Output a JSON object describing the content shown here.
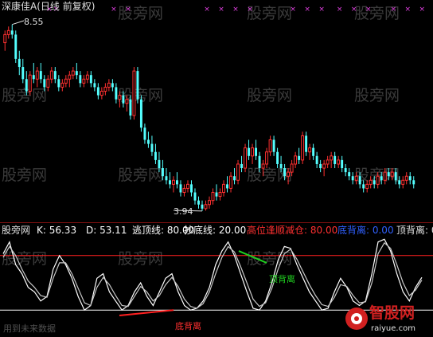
{
  "title": "深康佳A(日线 前复权)",
  "watermark": "股旁网",
  "colors": {
    "up": "#ff3030",
    "down": "#54ffff",
    "k": "#ffffff",
    "d": "#c8c8c8",
    "top_line": "#ff2020",
    "bottom_line": "#ffffff",
    "top_div": "#20d020",
    "bottom_div": "#ff2020"
  },
  "price_labels": {
    "high": "8.55",
    "low": "3.94"
  },
  "indicator": {
    "name": "股旁网",
    "k_label": "K: 56.33",
    "d_label": "D: 53.11",
    "escape_label": "逃顶线: 80.00",
    "bottom_label": "抄底线: 20.00",
    "reduce_label": "高位逢顺减仓: 80.00",
    "bottom_div_label": "底背离: 0.00",
    "top_div_label": "顶背离: 0"
  },
  "annotations": {
    "top_divergence": "顶背离",
    "bottom_divergence": "底背离",
    "footer_left": "用到未来数据"
  },
  "logo": {
    "name": "智股网",
    "url": "raiyue.com"
  },
  "chart_data": [
    {
      "type": "candlestick",
      "title": "深康佳A(日线 前复权)",
      "high_label": 8.55,
      "low_label": 3.94,
      "ylim": [
        3.8,
        8.8
      ],
      "candles": [
        [
          8.1,
          8.4,
          7.9,
          8.3
        ],
        [
          8.3,
          8.5,
          8.2,
          8.4
        ],
        [
          8.4,
          8.55,
          8.2,
          8.3
        ],
        [
          8.3,
          8.4,
          7.6,
          7.7
        ],
        [
          7.7,
          7.9,
          7.3,
          7.5
        ],
        [
          7.5,
          7.7,
          7.1,
          7.2
        ],
        [
          7.2,
          7.4,
          6.8,
          6.9
        ],
        [
          6.9,
          7.4,
          6.8,
          7.3
        ],
        [
          7.3,
          7.6,
          7.1,
          7.2
        ],
        [
          7.2,
          7.5,
          7.0,
          7.4
        ],
        [
          7.4,
          7.6,
          7.1,
          7.2
        ],
        [
          7.2,
          7.3,
          6.9,
          7.0
        ],
        [
          7.0,
          7.3,
          6.9,
          7.2
        ],
        [
          7.2,
          7.5,
          7.1,
          7.4
        ],
        [
          7.4,
          7.5,
          7.1,
          7.2
        ],
        [
          7.2,
          7.3,
          6.9,
          7.0
        ],
        [
          7.0,
          7.2,
          6.9,
          7.1
        ],
        [
          7.1,
          7.3,
          7.0,
          7.2
        ],
        [
          7.2,
          7.4,
          7.0,
          7.3
        ],
        [
          7.3,
          7.5,
          7.2,
          7.4
        ],
        [
          7.4,
          7.6,
          7.2,
          7.3
        ],
        [
          7.3,
          7.4,
          7.0,
          7.1
        ],
        [
          7.1,
          7.3,
          7.0,
          7.2
        ],
        [
          7.2,
          7.4,
          7.1,
          7.3
        ],
        [
          7.3,
          7.4,
          7.0,
          7.1
        ],
        [
          7.1,
          7.2,
          6.9,
          7.0
        ],
        [
          7.0,
          7.1,
          6.7,
          6.8
        ],
        [
          6.8,
          7.0,
          6.7,
          6.9
        ],
        [
          6.9,
          7.1,
          6.8,
          7.0
        ],
        [
          7.0,
          7.2,
          6.9,
          7.1
        ],
        [
          7.1,
          7.2,
          6.9,
          7.0
        ],
        [
          7.0,
          7.1,
          6.6,
          6.7
        ],
        [
          6.7,
          6.9,
          6.5,
          6.8
        ],
        [
          6.8,
          6.9,
          6.5,
          6.6
        ],
        [
          6.6,
          6.8,
          6.4,
          6.7
        ],
        [
          6.7,
          6.8,
          6.2,
          6.3
        ],
        [
          6.3,
          7.5,
          6.2,
          7.4
        ],
        [
          7.4,
          7.5,
          6.6,
          6.7
        ],
        [
          6.7,
          6.8,
          5.9,
          6.0
        ],
        [
          6.0,
          6.1,
          5.6,
          5.7
        ],
        [
          5.7,
          5.9,
          5.5,
          5.6
        ],
        [
          5.6,
          5.8,
          5.3,
          5.4
        ],
        [
          5.4,
          5.6,
          5.1,
          5.2
        ],
        [
          5.2,
          5.4,
          4.9,
          5.0
        ],
        [
          5.0,
          5.2,
          4.7,
          4.8
        ],
        [
          4.8,
          5.0,
          4.6,
          4.7
        ],
        [
          4.7,
          4.9,
          4.5,
          4.6
        ],
        [
          4.6,
          4.8,
          4.4,
          4.7
        ],
        [
          4.7,
          4.9,
          4.5,
          4.6
        ],
        [
          4.6,
          4.7,
          4.3,
          4.4
        ],
        [
          4.4,
          4.6,
          4.3,
          4.5
        ],
        [
          4.5,
          4.7,
          4.4,
          4.6
        ],
        [
          4.6,
          4.7,
          4.3,
          4.4
        ],
        [
          4.4,
          4.5,
          4.1,
          4.2
        ],
        [
          4.2,
          4.3,
          4.0,
          4.1
        ],
        [
          4.1,
          4.2,
          3.94,
          4.0
        ],
        [
          4.0,
          4.2,
          3.95,
          4.1
        ],
        [
          4.1,
          4.3,
          4.0,
          4.2
        ],
        [
          4.2,
          4.5,
          4.1,
          4.4
        ],
        [
          4.4,
          4.6,
          4.2,
          4.3
        ],
        [
          4.3,
          4.5,
          4.2,
          4.4
        ],
        [
          4.4,
          4.7,
          4.3,
          4.6
        ],
        [
          4.6,
          4.8,
          4.4,
          4.5
        ],
        [
          4.5,
          4.9,
          4.4,
          4.8
        ],
        [
          4.8,
          5.0,
          4.6,
          4.7
        ],
        [
          4.7,
          5.2,
          4.6,
          5.1
        ],
        [
          5.1,
          5.3,
          4.9,
          5.0
        ],
        [
          5.0,
          5.6,
          4.9,
          5.5
        ],
        [
          5.5,
          5.7,
          5.2,
          5.3
        ],
        [
          5.3,
          5.6,
          5.1,
          5.5
        ],
        [
          5.5,
          5.7,
          5.2,
          5.3
        ],
        [
          5.3,
          5.4,
          4.9,
          5.0
        ],
        [
          5.0,
          5.2,
          4.8,
          5.1
        ],
        [
          5.1,
          5.5,
          5.0,
          5.4
        ],
        [
          5.4,
          5.8,
          5.3,
          5.7
        ],
        [
          5.7,
          5.8,
          5.3,
          5.4
        ],
        [
          5.4,
          5.5,
          5.0,
          5.1
        ],
        [
          5.1,
          5.3,
          4.9,
          5.0
        ],
        [
          5.0,
          5.1,
          4.7,
          4.8
        ],
        [
          4.8,
          5.0,
          4.6,
          4.9
        ],
        [
          4.9,
          5.2,
          4.8,
          5.1
        ],
        [
          5.1,
          5.4,
          5.0,
          5.3
        ],
        [
          5.3,
          5.5,
          5.1,
          5.2
        ],
        [
          5.2,
          5.9,
          5.1,
          5.8
        ],
        [
          5.8,
          5.9,
          5.3,
          5.4
        ],
        [
          5.4,
          5.6,
          5.2,
          5.5
        ],
        [
          5.5,
          5.6,
          5.2,
          5.3
        ],
        [
          5.3,
          5.4,
          5.0,
          5.1
        ],
        [
          5.1,
          5.2,
          4.9,
          5.0
        ],
        [
          5.0,
          5.2,
          4.8,
          5.1
        ],
        [
          5.1,
          5.3,
          5.0,
          5.2
        ],
        [
          5.2,
          5.4,
          5.0,
          5.3
        ],
        [
          5.3,
          5.4,
          5.0,
          5.1
        ],
        [
          5.1,
          5.3,
          5.0,
          5.2
        ],
        [
          5.2,
          5.3,
          4.9,
          5.0
        ],
        [
          5.0,
          5.1,
          4.8,
          4.9
        ],
        [
          4.9,
          5.0,
          4.7,
          4.8
        ],
        [
          4.8,
          4.9,
          4.6,
          4.7
        ],
        [
          4.7,
          4.9,
          4.6,
          4.8
        ],
        [
          4.8,
          4.9,
          4.5,
          4.6
        ],
        [
          4.6,
          4.7,
          4.4,
          4.5
        ],
        [
          4.5,
          4.7,
          4.4,
          4.6
        ],
        [
          4.6,
          4.8,
          4.5,
          4.7
        ],
        [
          4.7,
          4.8,
          4.5,
          4.6
        ],
        [
          4.6,
          4.9,
          4.5,
          4.8
        ],
        [
          4.8,
          4.9,
          4.6,
          4.7
        ],
        [
          4.7,
          5.0,
          4.6,
          4.9
        ],
        [
          4.9,
          5.0,
          4.7,
          4.8
        ],
        [
          4.8,
          5.0,
          4.7,
          4.9
        ],
        [
          4.9,
          5.0,
          4.6,
          4.7
        ],
        [
          4.7,
          4.8,
          4.5,
          4.6
        ],
        [
          4.6,
          4.8,
          4.5,
          4.7
        ],
        [
          4.7,
          4.9,
          4.6,
          4.8
        ],
        [
          4.8,
          4.9,
          4.6,
          4.7
        ],
        [
          4.7,
          4.8,
          4.5,
          4.6
        ]
      ]
    },
    {
      "type": "line",
      "title": "股旁网",
      "ylim": [
        0,
        100
      ],
      "reference_lines": [
        {
          "name": "逃顶线",
          "value": 80
        },
        {
          "name": "抄底线",
          "value": 20
        }
      ],
      "series": [
        {
          "name": "K",
          "values": [
            82,
            95,
            70,
            60,
            45,
            40,
            30,
            35,
            65,
            80,
            70,
            55,
            35,
            20,
            25,
            55,
            60,
            40,
            30,
            20,
            25,
            40,
            50,
            35,
            25,
            40,
            55,
            60,
            40,
            25,
            20,
            22,
            30,
            45,
            70,
            85,
            95,
            80,
            60,
            40,
            22,
            20,
            30,
            50,
            75,
            90,
            88,
            70,
            55,
            40,
            30,
            20,
            22,
            40,
            55,
            45,
            30,
            25,
            30,
            60,
            95,
            98,
            85,
            60,
            40,
            30,
            45,
            56
          ]
        },
        {
          "name": "D",
          "values": [
            78,
            90,
            80,
            65,
            52,
            45,
            36,
            34,
            55,
            72,
            72,
            60,
            44,
            28,
            25,
            45,
            56,
            48,
            36,
            25,
            24,
            35,
            46,
            40,
            30,
            36,
            48,
            56,
            46,
            32,
            24,
            22,
            27,
            40,
            60,
            78,
            90,
            84,
            68,
            50,
            32,
            24,
            28,
            44,
            65,
            82,
            87,
            76,
            62,
            48,
            36,
            26,
            24,
            34,
            48,
            46,
            36,
            28,
            29,
            50,
            82,
            94,
            88,
            70,
            50,
            36,
            42,
            53
          ]
        }
      ]
    }
  ]
}
